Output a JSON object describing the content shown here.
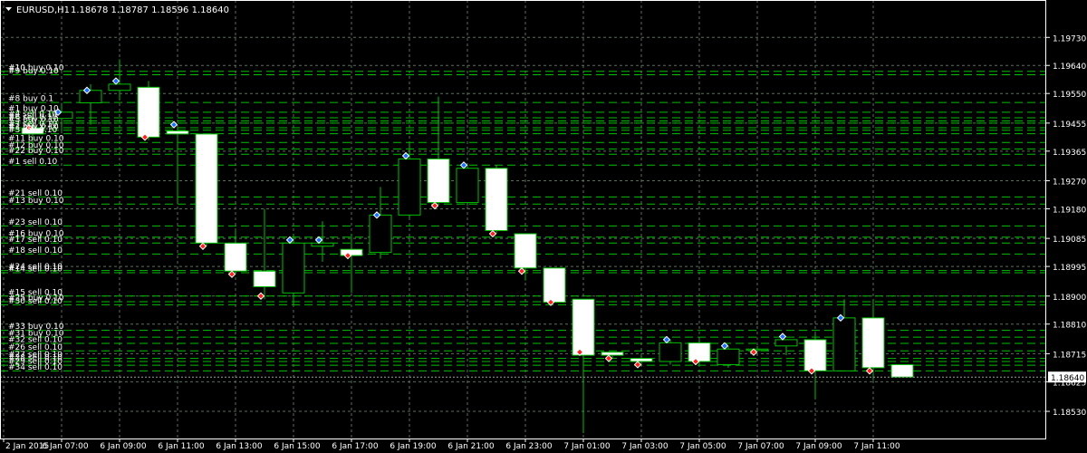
{
  "header": {
    "symbol_timeframe": "EURUSD,H1",
    "ohlc": "1.18678 1.18787 1.18596 1.18640"
  },
  "colors": {
    "background": "#000000",
    "frame": "#ffffff",
    "grid": "#5a6f5a",
    "bull_body": "#000000",
    "bear_body": "#ffffff",
    "candle_outline": "#00c000",
    "wick": "#00c000",
    "order_line": "#00c000",
    "buy_marker": "#1e6fff",
    "sell_marker": "#ff2020",
    "price_label_bg": "#ffffff",
    "price_label_text": "#000000",
    "text": "#ffffff"
  },
  "chart_data": {
    "type": "candlestick",
    "price_axis": {
      "ylim": [
        1.1844,
        1.1985
      ],
      "ticks": [
        "1.19730",
        "1.19640",
        "1.19550",
        "1.19455",
        "1.19365",
        "1.19270",
        "1.19180",
        "1.19085",
        "1.18995",
        "1.18900",
        "1.18810",
        "1.18715",
        "1.18625",
        "1.18530"
      ],
      "current_price": "1.18640"
    },
    "time_axis": {
      "labels": [
        "2 Jan 2015",
        "6 Jan 07:00",
        "6 Jan 09:00",
        "6 Jan 11:00",
        "6 Jan 13:00",
        "6 Jan 15:00",
        "6 Jan 17:00",
        "6 Jan 19:00",
        "6 Jan 21:00",
        "6 Jan 23:00",
        "7 Jan 01:00",
        "7 Jan 03:00",
        "7 Jan 05:00",
        "7 Jan 07:00",
        "7 Jan 09:00",
        "7 Jan 11:00"
      ]
    },
    "candles": [
      {
        "o": 1.1944,
        "h": 1.195,
        "l": 1.1936,
        "c": 1.1942
      },
      {
        "o": 1.1947,
        "h": 1.1952,
        "l": 1.1943,
        "c": 1.1949
      },
      {
        "o": 1.1952,
        "h": 1.1958,
        "l": 1.1945,
        "c": 1.1956
      },
      {
        "o": 1.1956,
        "h": 1.1966,
        "l": 1.1953,
        "c": 1.1958
      },
      {
        "o": 1.1957,
        "h": 1.1959,
        "l": 1.194,
        "c": 1.1941
      },
      {
        "o": 1.1943,
        "h": 1.1944,
        "l": 1.192,
        "c": 1.1942
      },
      {
        "o": 1.1942,
        "h": 1.1942,
        "l": 1.1906,
        "c": 1.1907
      },
      {
        "o": 1.1907,
        "h": 1.1911,
        "l": 1.1899,
        "c": 1.1898
      },
      {
        "o": 1.1898,
        "h": 1.1918,
        "l": 1.1889,
        "c": 1.1893
      },
      {
        "o": 1.1891,
        "h": 1.191,
        "l": 1.1887,
        "c": 1.1907
      },
      {
        "o": 1.1906,
        "h": 1.1914,
        "l": 1.1901,
        "c": 1.1907
      },
      {
        "o": 1.1905,
        "h": 1.191,
        "l": 1.1891,
        "c": 1.1903
      },
      {
        "o": 1.1904,
        "h": 1.1925,
        "l": 1.1902,
        "c": 1.1916
      },
      {
        "o": 1.1916,
        "h": 1.1939,
        "l": 1.1915,
        "c": 1.1934
      },
      {
        "o": 1.1934,
        "h": 1.1954,
        "l": 1.192,
        "c": 1.192
      },
      {
        "o": 1.192,
        "h": 1.1932,
        "l": 1.1919,
        "c": 1.1931
      },
      {
        "o": 1.1931,
        "h": 1.1932,
        "l": 1.191,
        "c": 1.1911
      },
      {
        "o": 1.191,
        "h": 1.191,
        "l": 1.1895,
        "c": 1.1899
      },
      {
        "o": 1.1899,
        "h": 1.1899,
        "l": 1.1888,
        "c": 1.1888
      },
      {
        "o": 1.1889,
        "h": 1.1889,
        "l": 1.1846,
        "c": 1.1871
      },
      {
        "o": 1.1872,
        "h": 1.1872,
        "l": 1.187,
        "c": 1.1871
      },
      {
        "o": 1.187,
        "h": 1.1871,
        "l": 1.1868,
        "c": 1.1869
      },
      {
        "o": 1.1869,
        "h": 1.1876,
        "l": 1.1868,
        "c": 1.1875
      },
      {
        "o": 1.1875,
        "h": 1.1876,
        "l": 1.1868,
        "c": 1.1869
      },
      {
        "o": 1.1868,
        "h": 1.1874,
        "l": 1.1867,
        "c": 1.1873
      },
      {
        "o": 1.1873,
        "h": 1.1874,
        "l": 1.1872,
        "c": 1.1873
      },
      {
        "o": 1.1874,
        "h": 1.1876,
        "l": 1.1871,
        "c": 1.1876
      },
      {
        "o": 1.1876,
        "h": 1.1878,
        "l": 1.1857,
        "c": 1.1866
      },
      {
        "o": 1.1866,
        "h": 1.1889,
        "l": 1.1866,
        "c": 1.1883
      },
      {
        "o": 1.1883,
        "h": 1.1889,
        "l": 1.1863,
        "c": 1.1867
      },
      {
        "o": 1.1868,
        "h": 1.1868,
        "l": 1.1864,
        "c": 1.1864
      }
    ],
    "orders": [
      {
        "label": "#10 buy 0.10",
        "price": 1.19621
      },
      {
        "label": "#9 buy 0.10",
        "price": 1.1961
      },
      {
        "label": "#8 buy 0.1",
        "price": 1.19521
      },
      {
        "label": "#1 buy 0.10",
        "price": 1.1949
      },
      {
        "label": "#4 sell 0.10",
        "price": 1.19472
      },
      {
        "label": "#6 sell 0.10",
        "price": 1.19462
      },
      {
        "label": "#5 buy 0.10",
        "price": 1.19455
      },
      {
        "label": "#7 sell 0.10",
        "price": 1.1944
      },
      {
        "label": "#2 buy 0.10",
        "price": 1.19432
      },
      {
        "label": "#3 sell 0.10",
        "price": 1.19421
      },
      {
        "label": "#11 buy 0.10",
        "price": 1.19393
      },
      {
        "label": "#12 buy 0.10",
        "price": 1.19372
      },
      {
        "label": "#22 buy 0.10",
        "price": 1.19355
      },
      {
        "label": "#1 sell 0.10",
        "price": 1.1932
      },
      {
        "label": "#21 sell 0.10",
        "price": 1.19218
      },
      {
        "label": "#13 buy 0.10",
        "price": 1.19195
      },
      {
        "label": "#23 sell 0.10",
        "price": 1.19125
      },
      {
        "label": "#16 buy 0.10",
        "price": 1.19089
      },
      {
        "label": "#17 sell 0.10",
        "price": 1.1907
      },
      {
        "label": "#18 sell 0.10",
        "price": 1.19035
      },
      {
        "label": "#24 sell 0.10",
        "price": 1.18982
      },
      {
        "label": "#14 sell 0.10",
        "price": 1.18975
      },
      {
        "label": "#15 sell 0.10",
        "price": 1.189
      },
      {
        "label": "#25 buy 0.10",
        "price": 1.18882
      },
      {
        "label": "#30 sell 0.10",
        "price": 1.18872
      },
      {
        "label": "#33 buy 0.10",
        "price": 1.1879
      },
      {
        "label": "#31 buy 0.10",
        "price": 1.18768
      },
      {
        "label": "#32 sell 0.10",
        "price": 1.18748
      },
      {
        "label": "#26 sell 0.10",
        "price": 1.18724
      },
      {
        "label": "#27 sell 0.10",
        "price": 1.187
      },
      {
        "label": "#28 sell 0.10",
        "price": 1.1869
      },
      {
        "label": "#29 sell 0.10",
        "price": 1.18678
      },
      {
        "label": "#34 sell 0.10",
        "price": 1.1866
      }
    ],
    "markers": [
      {
        "i": 1,
        "type": "buy",
        "price": 1.1949
      },
      {
        "i": 0,
        "type": "sell",
        "price": 1.1944
      },
      {
        "i": 2,
        "type": "buy",
        "price": 1.1956
      },
      {
        "i": 3,
        "type": "buy",
        "price": 1.1959
      },
      {
        "i": 4,
        "type": "sell",
        "price": 1.1941
      },
      {
        "i": 5,
        "type": "buy",
        "price": 1.1945
      },
      {
        "i": 6,
        "type": "sell",
        "price": 1.1906
      },
      {
        "i": 7,
        "type": "sell",
        "price": 1.1897
      },
      {
        "i": 8,
        "type": "sell",
        "price": 1.189
      },
      {
        "i": 9,
        "type": "buy",
        "price": 1.1908
      },
      {
        "i": 10,
        "type": "buy",
        "price": 1.1908
      },
      {
        "i": 11,
        "type": "sell",
        "price": 1.1903
      },
      {
        "i": 12,
        "type": "buy",
        "price": 1.1916
      },
      {
        "i": 13,
        "type": "buy",
        "price": 1.1935
      },
      {
        "i": 14,
        "type": "sell",
        "price": 1.1919
      },
      {
        "i": 15,
        "type": "buy",
        "price": 1.1932
      },
      {
        "i": 16,
        "type": "sell",
        "price": 1.191
      },
      {
        "i": 17,
        "type": "sell",
        "price": 1.1898
      },
      {
        "i": 18,
        "type": "sell",
        "price": 1.1888
      },
      {
        "i": 19,
        "type": "sell",
        "price": 1.1872
      },
      {
        "i": 20,
        "type": "sell",
        "price": 1.187
      },
      {
        "i": 21,
        "type": "sell",
        "price": 1.1868
      },
      {
        "i": 22,
        "type": "buy",
        "price": 1.1876
      },
      {
        "i": 23,
        "type": "sell",
        "price": 1.1869
      },
      {
        "i": 24,
        "type": "buy",
        "price": 1.1874
      },
      {
        "i": 25,
        "type": "sell",
        "price": 1.1872
      },
      {
        "i": 26,
        "type": "buy",
        "price": 1.1877
      },
      {
        "i": 27,
        "type": "sell",
        "price": 1.1866
      },
      {
        "i": 28,
        "type": "buy",
        "price": 1.1883
      },
      {
        "i": 29,
        "type": "sell",
        "price": 1.1866
      }
    ]
  }
}
